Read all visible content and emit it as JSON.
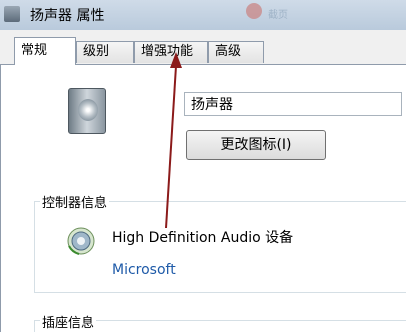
{
  "window": {
    "title": "扬声器 属性",
    "background_title_text": "",
    "background_title_text2": "截页"
  },
  "tabs": [
    {
      "label": "常规",
      "active": true
    },
    {
      "label": "级别",
      "active": false
    },
    {
      "label": "增强功能",
      "active": false
    },
    {
      "label": "高级",
      "active": false
    }
  ],
  "general": {
    "device_label": "扬声器",
    "change_icon_button": "更改图标(I)",
    "controller_section": "控制器信息",
    "controller_name": "High Definition Audio 设备",
    "controller_vendor": "Microsoft",
    "jack_section": "插座信息"
  },
  "annotation": {
    "arrow_color": "#8b1a1a"
  }
}
